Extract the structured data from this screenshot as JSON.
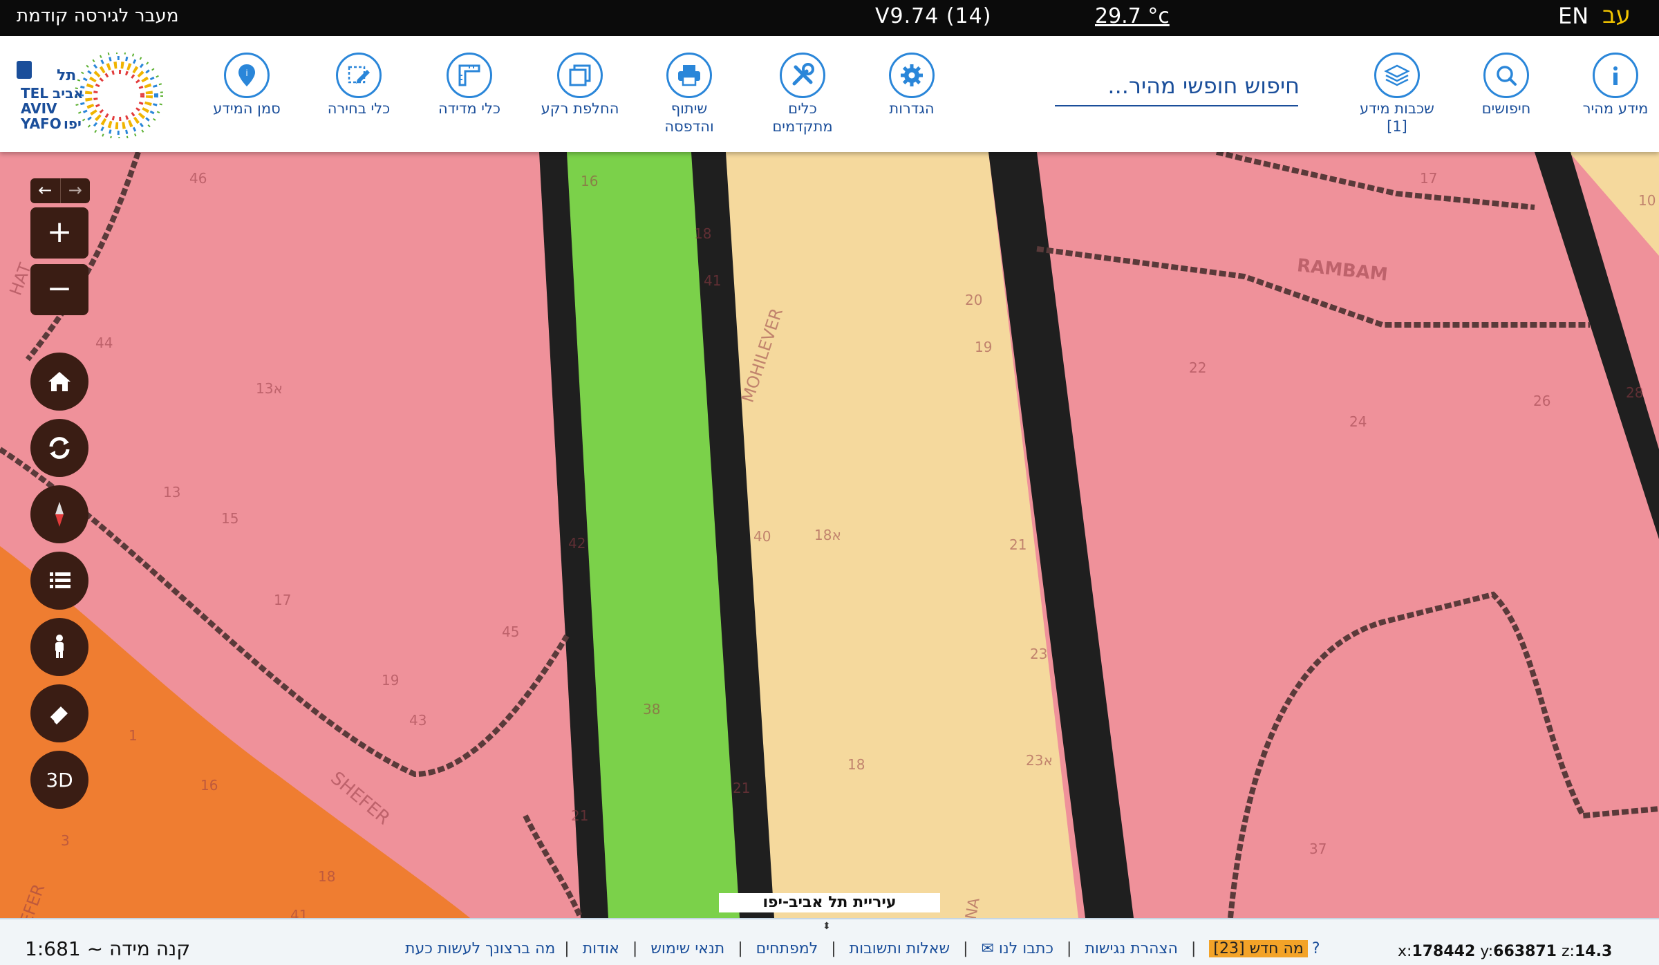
{
  "topbar": {
    "legacy_link": "מעבר לגירסה קודמת",
    "version": "V9.74 (14)",
    "temperature": "29.7 °c",
    "lang_en": "EN",
    "lang_he": "עב"
  },
  "logo": {
    "text_he_top": "תל",
    "text_he_mid": "אביב",
    "text_he_bottom": "יפו",
    "text_en_1": "TEL",
    "text_en_2": "AVIV",
    "text_en_3": "YAFO"
  },
  "toolbar": {
    "quick_info": "מידע מהיר",
    "searches": "חיפושים",
    "layers_line1": "שכבות מידע",
    "layers_line2": "[1]",
    "settings": "הגדרות",
    "advanced_line1": "כלים",
    "advanced_line2": "מתקדמים",
    "share_line1": "שיתוף",
    "share_line2": "והדפסה",
    "switch_base": "החלפת רקע",
    "measure": "כלי מדידה",
    "select": "כלי בחירה",
    "info_marker": "סמן המידע",
    "search_placeholder": "חיפוש חופשי מהיר..."
  },
  "map_controls": {
    "zoom_in": "+",
    "zoom_out": "−",
    "three_d": "3D",
    "arrow_left": "←",
    "arrow_right": "→"
  },
  "map_labels": {
    "street_rambam": "RAMBAM",
    "street_mohilever": "MOHILEVER",
    "street_shefer": "SHEFER",
    "street_shefer_edge": "SHEFER",
    "street_hat": "HAT",
    "street_na": "NA",
    "n46": "46",
    "n44": "44",
    "n13a": "13א",
    "n13": "13",
    "n15": "15",
    "n17": "17",
    "n19": "19",
    "n43": "43",
    "n16": "16",
    "n1": "1",
    "n3": "3",
    "n18b": "18",
    "n45": "45",
    "n42": "42",
    "n16b": "16",
    "n18c": "18",
    "n41": "41",
    "n38": "38",
    "n21b": "21",
    "n21c": "21",
    "n40": "40",
    "n18a": "18א",
    "n20": "20",
    "n19b": "19",
    "n21": "21",
    "n23": "23",
    "n23a": "23א",
    "n18d": "18",
    "n17b": "17",
    "n22": "22",
    "n24": "24",
    "n26": "26",
    "n37": "37",
    "n10": "10",
    "n28": "28",
    "n41b": "41"
  },
  "city_label": "עיריית תל אביב-יפו",
  "bottombar": {
    "scale": "קנה מידה ~ 1:681",
    "news": "מה חדש [23]",
    "accessibility": "הצהרת נגישות",
    "contact": "כתבו לנו ✉",
    "faq": "שאלות ותשובות",
    "developers": "למפתחים",
    "terms": "תנאי שימוש",
    "about": "אודות",
    "what_now": "מה ברצונך לעשות כעת?",
    "sep": "|",
    "x_label": "x:",
    "x_value": "178442",
    "y_label": "y:",
    "y_value": "663871",
    "z_label": "z:",
    "z_value": "14.3"
  },
  "colors": {
    "residential": "#ef919a",
    "commercial": "#f5d99d",
    "park": "#7bd14a",
    "road_casing": "#1f1f1f",
    "orange_zone": "#ef7d31",
    "accent_blue": "#2a86d9",
    "control_brown": "#3a1d14",
    "news_badge": "#f3a328"
  }
}
